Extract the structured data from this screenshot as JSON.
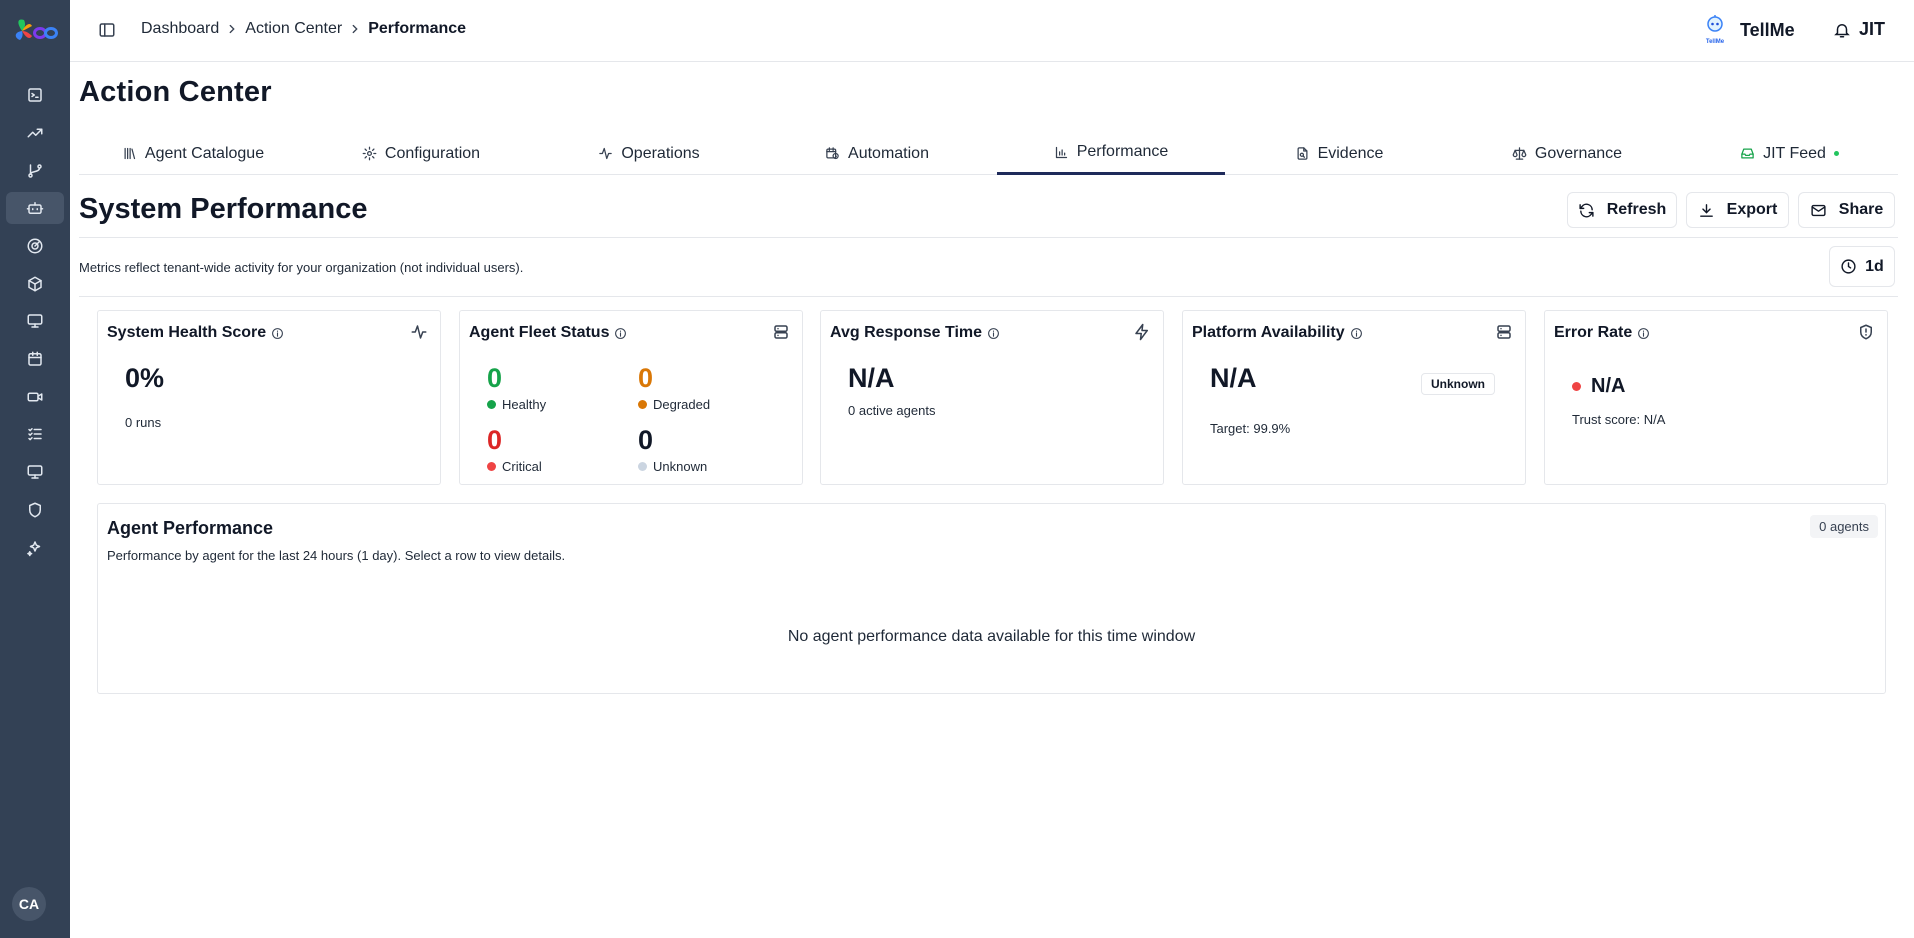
{
  "user": {
    "initials": "CA"
  },
  "header": {
    "breadcrumb": [
      "Dashboard",
      "Action Center",
      "Performance"
    ],
    "tellme_label": "TellMe",
    "tellme_icon_caption": "TellMe",
    "jit_label": "JIT"
  },
  "page": {
    "title": "Action Center"
  },
  "tabs": [
    {
      "label": "Agent Catalogue",
      "icon": "library-icon"
    },
    {
      "label": "Configuration",
      "icon": "gear-icon"
    },
    {
      "label": "Operations",
      "icon": "activity-icon"
    },
    {
      "label": "Automation",
      "icon": "calendar-clock-icon"
    },
    {
      "label": "Performance",
      "icon": "bar-chart-icon",
      "active": true
    },
    {
      "label": "Evidence",
      "icon": "file-search-icon"
    },
    {
      "label": "Governance",
      "icon": "scale-icon"
    },
    {
      "label": "JIT Feed",
      "icon": "inbox-icon"
    }
  ],
  "section": {
    "title": "System Performance",
    "refresh_label": "Refresh",
    "export_label": "Export",
    "share_label": "Share",
    "note": "Metrics reflect tenant-wide activity for your organization (not individual users).",
    "time_range": "1d"
  },
  "cards": {
    "health": {
      "title": "System Health Score",
      "value": "0%",
      "sub": "0 runs"
    },
    "fleet": {
      "title": "Agent Fleet Status",
      "healthy": {
        "value": "0",
        "label": "Healthy"
      },
      "degraded": {
        "value": "0",
        "label": "Degraded"
      },
      "critical": {
        "value": "0",
        "label": "Critical"
      },
      "unknown": {
        "value": "0",
        "label": "Unknown"
      }
    },
    "response": {
      "title": "Avg Response Time",
      "value": "N/A",
      "sub": "0 active agents"
    },
    "availability": {
      "title": "Platform Availability",
      "value": "N/A",
      "badge": "Unknown",
      "sub": "Target: 99.9%"
    },
    "error": {
      "title": "Error Rate",
      "value": "N/A",
      "sub": "Trust score: N/A"
    }
  },
  "agent_performance": {
    "title": "Agent Performance",
    "subtitle": "Performance by agent for the last 24 hours (1 day). Select a row to view details.",
    "count": "0 agents",
    "empty": "No agent performance data available for this time window"
  },
  "colors": {
    "sidebar": "#334155",
    "tab_active": "#1e2a5a",
    "healthy": "#16a34a",
    "degraded": "#d97706",
    "critical": "#dc2626",
    "unknown": "#cbd5e1",
    "error_dot": "#ef4444",
    "live": "#22c55e"
  }
}
